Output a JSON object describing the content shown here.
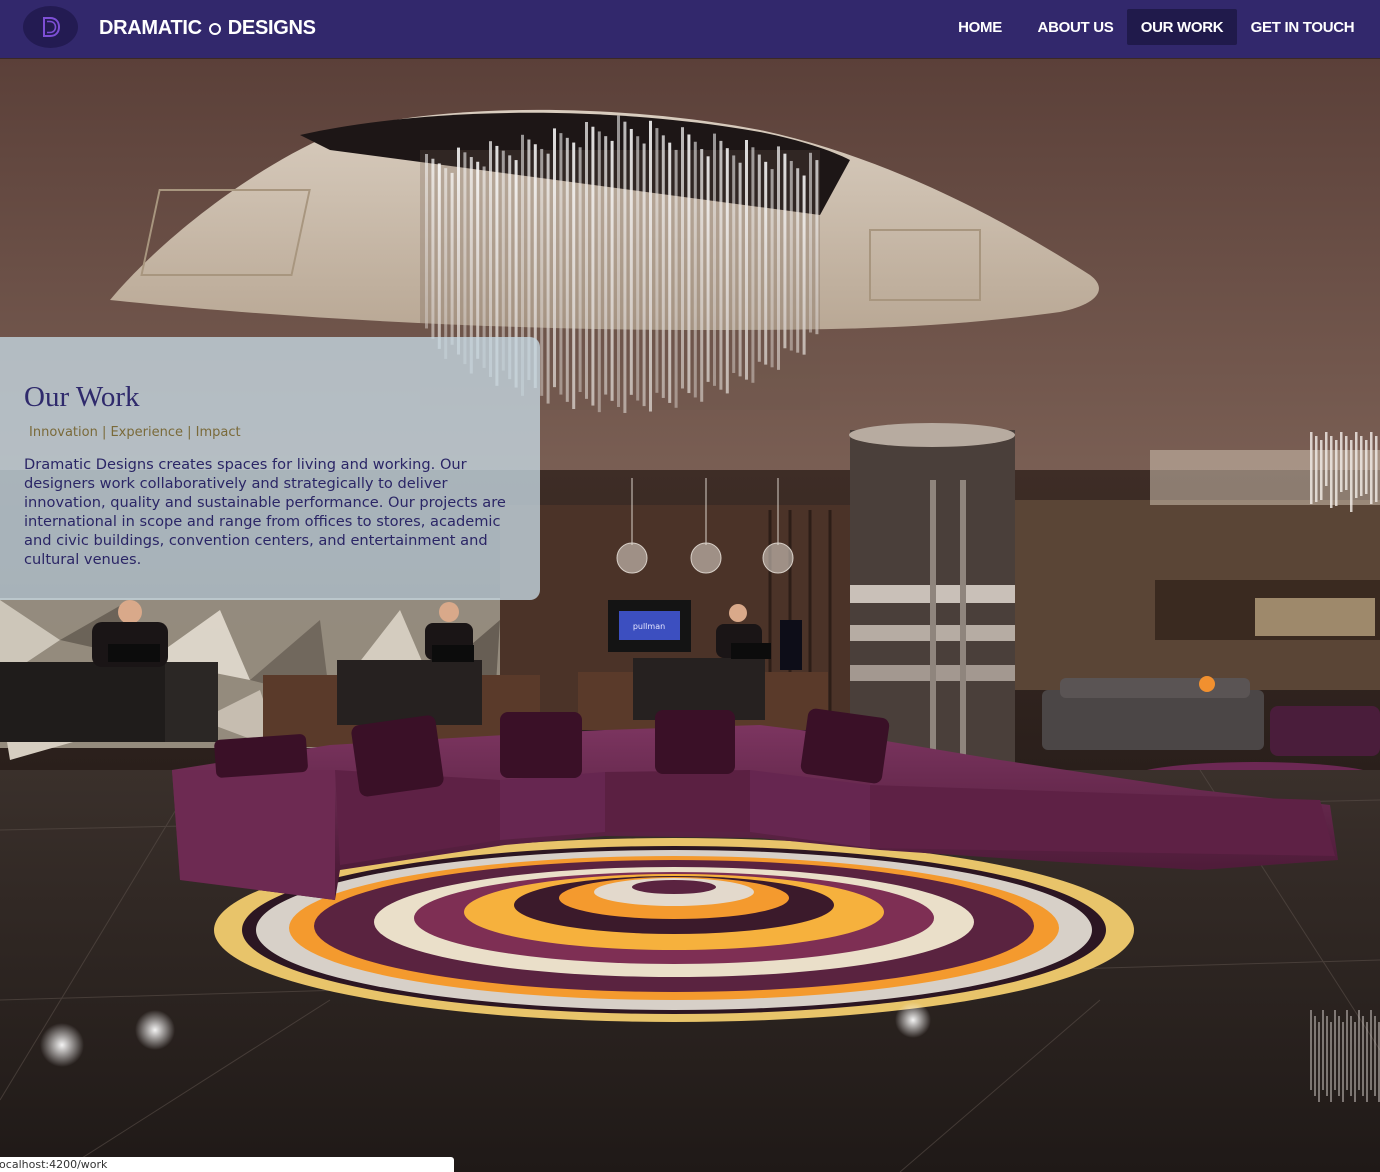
{
  "app": {
    "brand_left": "DRAMATIC",
    "brand_right": "DESIGNS",
    "logo_letter": "D",
    "accent_color": "#32286c",
    "accent_dark": "#201a4b"
  },
  "nav": {
    "items": [
      {
        "label": "HOME",
        "active": false
      },
      {
        "label": "ABOUT US",
        "active": false
      },
      {
        "label": "OUR WORK",
        "active": true
      },
      {
        "label": "GET IN TOUCH",
        "active": false
      }
    ]
  },
  "info": {
    "title": "Our Work",
    "tagline": "Innovation | Experience | Impact",
    "body": "Dramatic Designs creates spaces for living and working. Our designers work collaboratively and strategically to deliver innovation, quality and sustainable performance. Our projects are international in scope and range from offices to stores, academic and civic buildings, convention centers, and entertainment and cultural venues."
  },
  "hero": {
    "tv_screen_text": "pullman",
    "image_subject": "hotel-lobby-photo",
    "colors": {
      "sofa": "#5e2145",
      "floor": "#2b2421",
      "ceiling": "#6b5248",
      "rug_orange": "#f49a2e",
      "rug_gold": "#e8c46a"
    }
  },
  "status": {
    "url": "localhost:4200/work"
  }
}
